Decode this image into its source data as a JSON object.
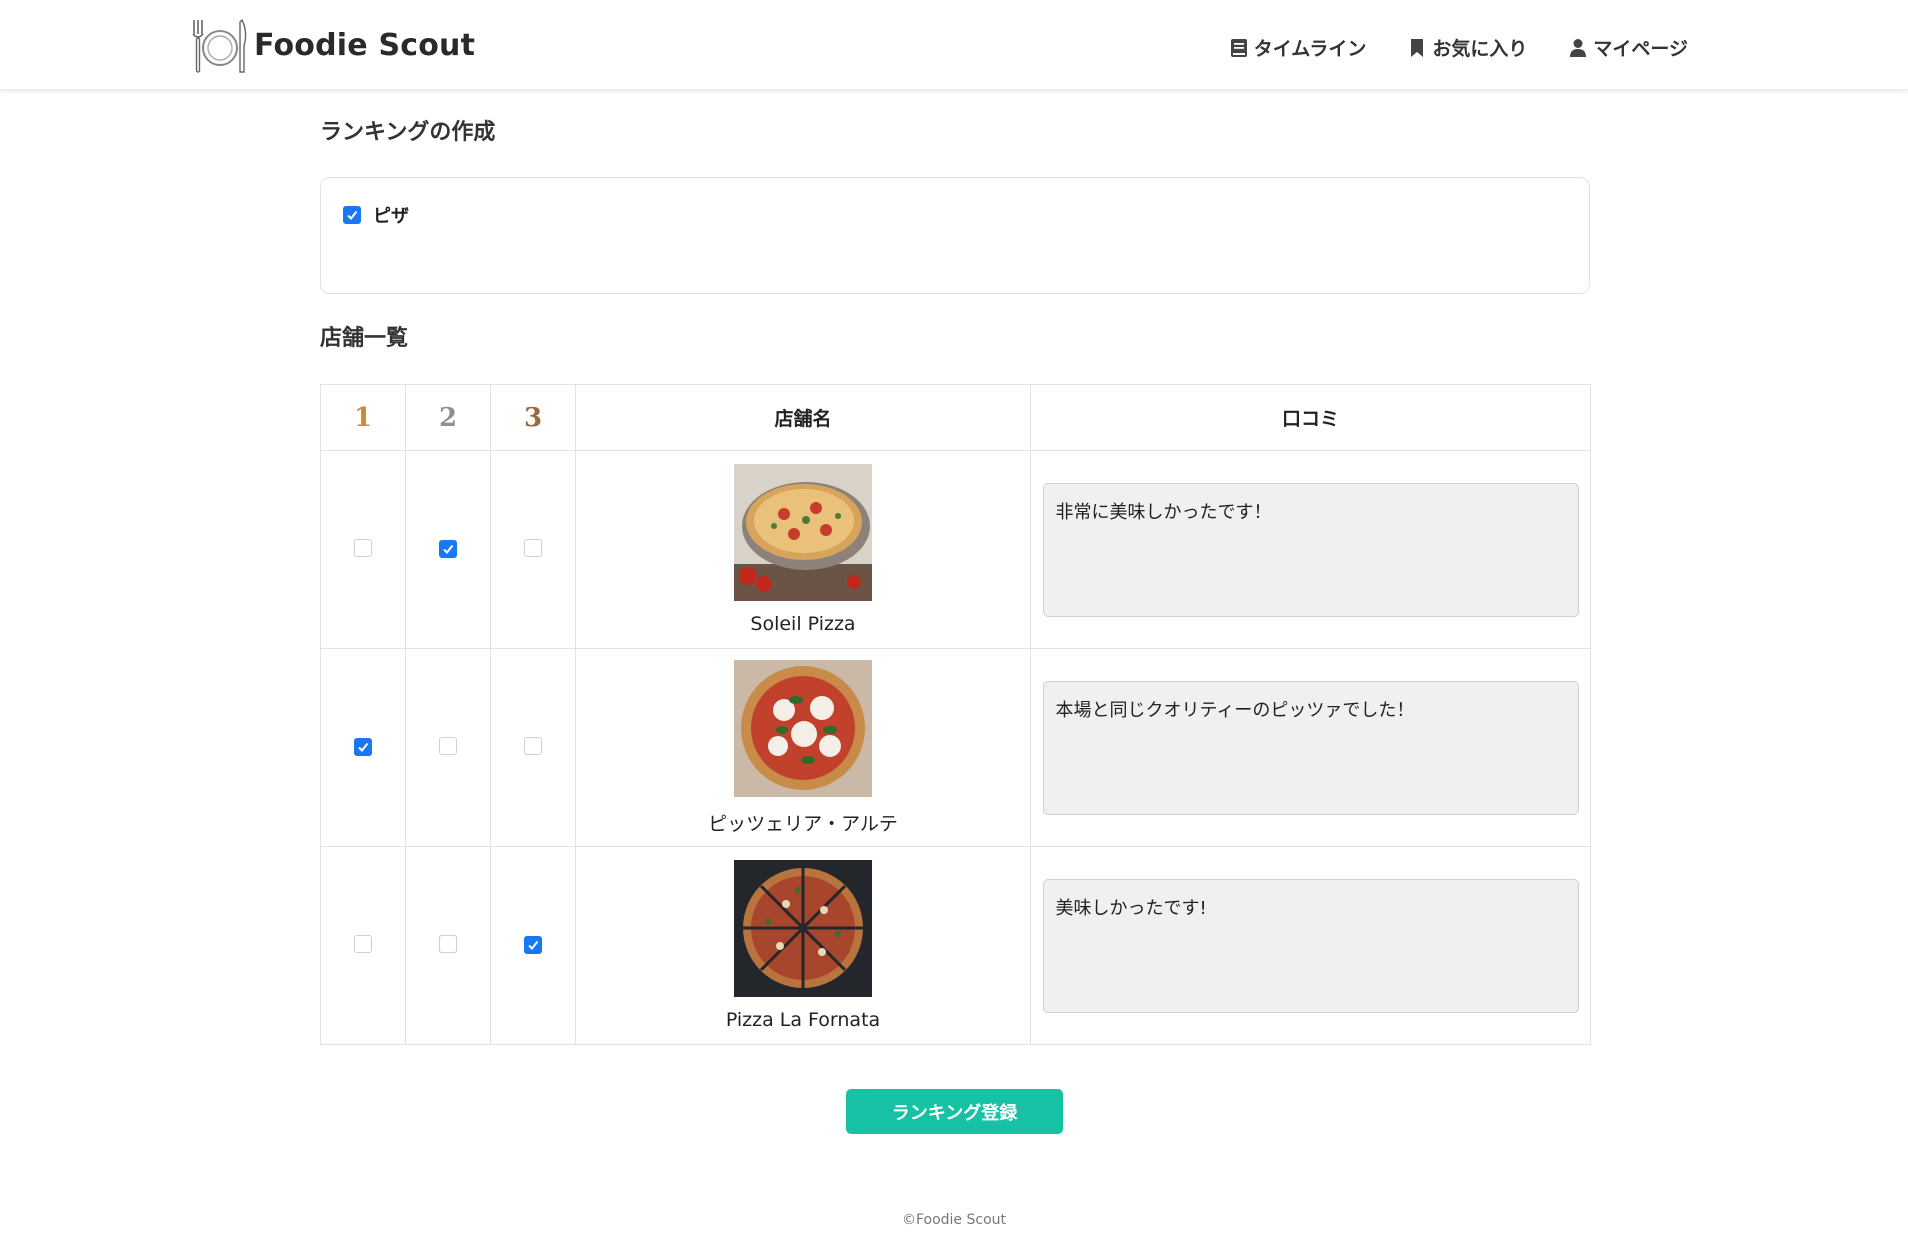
{
  "app": {
    "name": "Foodie Scout"
  },
  "nav": {
    "timeline": "タイムライン",
    "favorites": "お気に入り",
    "mypage": "マイページ"
  },
  "sections": {
    "ranking_create": "ランキングの作成",
    "store_list": "店舗一覧"
  },
  "category": {
    "label": "ピザ",
    "checked": true
  },
  "table": {
    "headers": {
      "rank1": "1",
      "rank2": "2",
      "rank3": "3",
      "store_name": "店舗名",
      "review": "口コミ"
    },
    "rows": [
      {
        "name": "Soleil Pizza",
        "rank": 2,
        "review": "非常に美味しかったです！"
      },
      {
        "name": "ピッツェリア・アルテ",
        "rank": 1,
        "review": "本場と同じクオリティーのピッツァでした！"
      },
      {
        "name": "Pizza La Fornata",
        "rank": 3,
        "review": "美味しかったです!"
      }
    ]
  },
  "submit_label": "ランキング登録",
  "footer": "©Foodie Scout",
  "colors": {
    "accent": "#17c1a3",
    "checkbox": "#1877f2"
  }
}
